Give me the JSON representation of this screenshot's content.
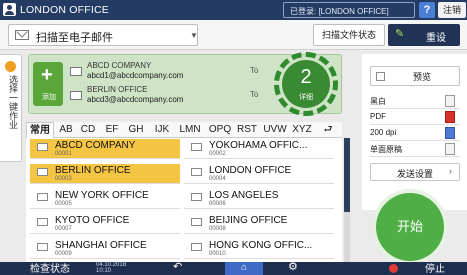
{
  "topbar": {
    "title": "LONDON OFFICE",
    "login_status": "已登录: [LONDON OFFICE]",
    "help": "?",
    "logout": "注销",
    "logout_short": "[",
    "user_icon": "user-icon"
  },
  "funcbar": {
    "function_label": "扫描至电子邮件",
    "scan_status": "扫描文件状态",
    "reset": "重设"
  },
  "side_tab": {
    "label": "选择一键作业"
  },
  "destinations": {
    "add_label": "添加",
    "items": [
      {
        "name": "ABCD COMPANY",
        "address": "abcd1@abcdcompany.com",
        "type": "To"
      },
      {
        "name": "BERLIN OFFICE",
        "address": "abcd3@abcdcompany.com",
        "type": "To"
      }
    ],
    "count": "2",
    "count_label": "详细"
  },
  "address_book": {
    "tabs": [
      "常用",
      "AB",
      "CD",
      "EF",
      "GH",
      "IJK",
      "LMN",
      "OPQ",
      "RST",
      "UVW",
      "XYZ",
      "⮐"
    ],
    "active_tab": "常用",
    "entries": [
      {
        "name": "ABCD COMPANY",
        "number": "00001",
        "selected": true
      },
      {
        "name": "YOKOHAMA OFFIC...",
        "number": "00002",
        "selected": false
      },
      {
        "name": "BERLIN OFFICE",
        "number": "00003",
        "selected": true
      },
      {
        "name": "LONDON OFFICE",
        "number": "00004",
        "selected": false
      },
      {
        "name": "NEW YORK OFFICE",
        "number": "00005",
        "selected": false
      },
      {
        "name": "LOS ANGELES",
        "number": "00006",
        "selected": false
      },
      {
        "name": "KYOTO OFFICE",
        "number": "00007",
        "selected": false
      },
      {
        "name": "BEIJING OFFICE",
        "number": "00008",
        "selected": false
      },
      {
        "name": "SHANGHAI OFFICE",
        "number": "00009",
        "selected": false
      },
      {
        "name": "HONG KONG OFFIC...",
        "number": "00010",
        "selected": false
      }
    ]
  },
  "settings": {
    "preview": "预览",
    "rows": [
      {
        "label": "黑白",
        "icon": "color-mode-icon",
        "style": ""
      },
      {
        "label": "PDF",
        "icon": "pdf-icon",
        "style": "red"
      },
      {
        "label": "200 dpi",
        "icon": "resolution-icon",
        "style": "blue"
      },
      {
        "label": "单面原稿",
        "icon": "one-sided-icon",
        "style": ""
      }
    ],
    "send_settings": "发送设置",
    "start": "开始"
  },
  "bottombar": {
    "status": "检查状态",
    "time": "04.10.2018",
    "time2": "10:10",
    "back": "↶",
    "home": "⌂",
    "gear": "⚙",
    "stop": "停止"
  },
  "colors": {
    "header": "#243b63",
    "selected": "#f4c542",
    "start": "#4fae45",
    "dest_panel": "#cfe3c6",
    "highlight_ring": "#2e8b2e"
  }
}
